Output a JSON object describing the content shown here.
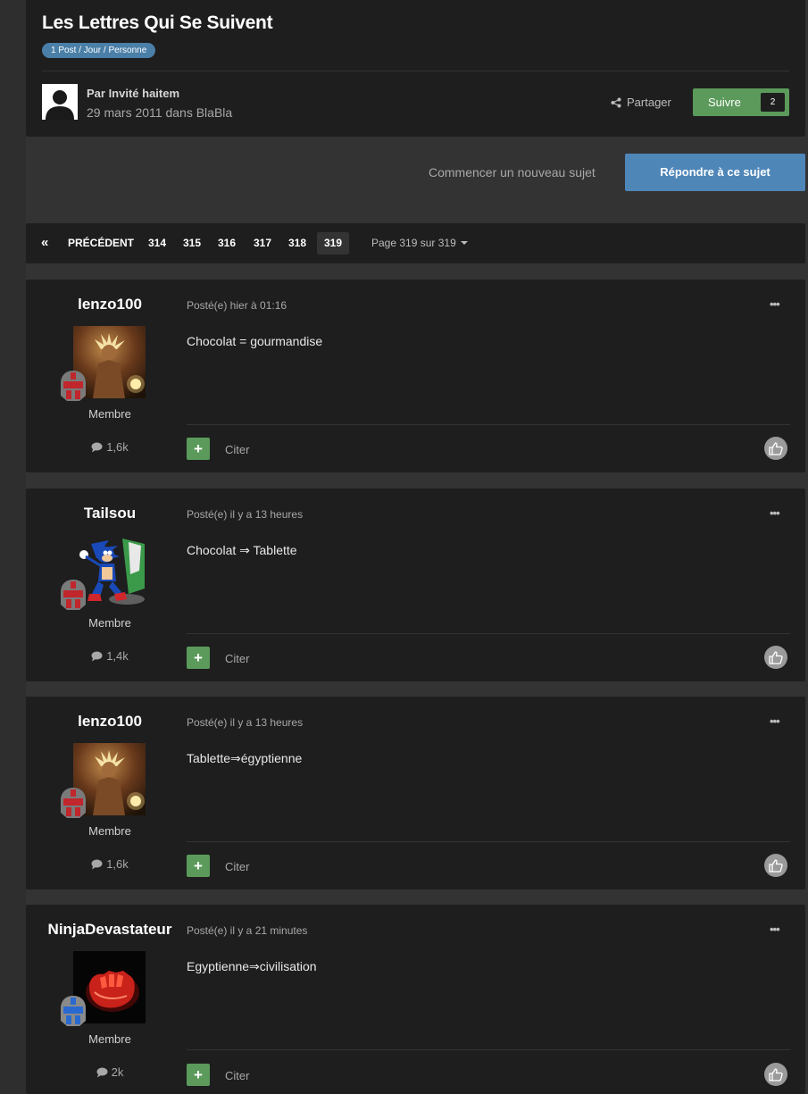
{
  "topic": {
    "title": "Les Lettres Qui Se Suivent",
    "badge": "1 Post / Jour / Personne",
    "author_label": "Par Invité haitem",
    "author_meta": "29 mars 2011 dans BlaBla",
    "share_label": "Partager",
    "follow_label": "Suivre",
    "follow_count": "2"
  },
  "actions": {
    "new_topic": "Commencer un nouveau sujet",
    "reply": "Répondre à ce sujet"
  },
  "pagination": {
    "first": "«",
    "prev": "PRÉCÉDENT",
    "pages": [
      "314",
      "315",
      "316",
      "317",
      "318",
      "319"
    ],
    "current": "319",
    "info": "Page 319 sur 319"
  },
  "posts": [
    {
      "username": "lenzo100",
      "group": "Membre",
      "count": "1,6k",
      "date": "Posté(e) hier à 01:16",
      "body": "Chocolat = gourmandise",
      "menu": "•••",
      "plus": "+",
      "quote": "Citer"
    },
    {
      "username": "Tailsou",
      "group": "Membre",
      "count": "1,4k",
      "date": "Posté(e) il y a 13 heures",
      "body": "Chocolat ⇒ Tablette",
      "menu": "•••",
      "plus": "+",
      "quote": "Citer"
    },
    {
      "username": "lenzo100",
      "group": "Membre",
      "count": "1,6k",
      "date": "Posté(e) il y a 13 heures",
      "body": "Tablette⇒égyptienne",
      "menu": "•••",
      "plus": "+",
      "quote": "Citer"
    },
    {
      "username": "NinjaDevastateur",
      "group": "Membre",
      "count": "2k",
      "date": "Posté(e) il y a 21 minutes",
      "body": "Egyptienne⇒civilisation",
      "menu": "•••",
      "plus": "+",
      "quote": "Citer"
    }
  ],
  "colors": {
    "background": "#333333",
    "card": "#1e1e1e",
    "accent_blue": "#4e86b8",
    "accent_green": "#5b9a5b"
  }
}
